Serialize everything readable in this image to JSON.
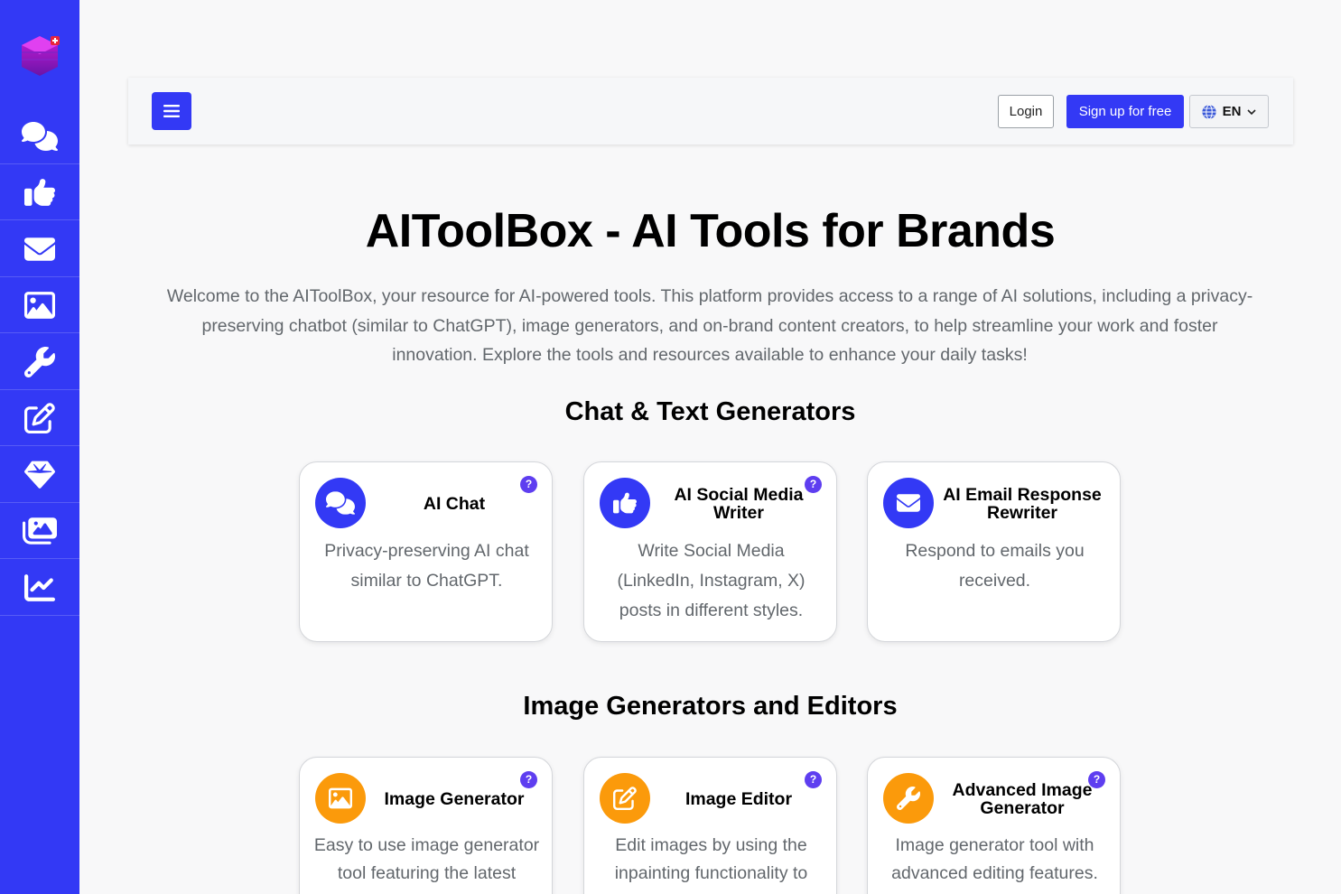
{
  "header": {
    "login_label": "Login",
    "signup_label": "Sign up for free",
    "language_code": "EN"
  },
  "hero": {
    "title": "AIToolBox - AI Tools for Brands",
    "description": "Welcome to the AIToolBox, your resource for AI-powered tools. This platform provides access to a range of AI solutions, including a privacy-preserving chatbot (similar to ChatGPT), image generators, and on-brand content creators, to help streamline your work and foster innovation. Explore the tools and resources available to enhance your daily tasks!"
  },
  "sidebar": {
    "items": [
      {
        "icon": "comments-icon"
      },
      {
        "icon": "thumbs-up-icon"
      },
      {
        "icon": "envelope-icon"
      },
      {
        "icon": "image-icon"
      },
      {
        "icon": "wrench-icon"
      },
      {
        "icon": "edit-icon"
      },
      {
        "icon": "diamond-icon"
      },
      {
        "icon": "images-icon"
      },
      {
        "icon": "chart-line-icon"
      }
    ]
  },
  "sections": [
    {
      "title": "Chat & Text Generators",
      "cards": [
        {
          "title": "AI Chat",
          "description": "Privacy-preserving AI chat similar to ChatGPT.",
          "icon": "comments-icon",
          "help": "?"
        },
        {
          "title": "AI Social Media Writer",
          "description": "Write Social Media (LinkedIn, Instagram, X) posts in different styles.",
          "icon": "thumbs-up-icon",
          "help": "?"
        },
        {
          "title": "AI Email Response Rewriter",
          "description": "Respond to emails you received.",
          "icon": "envelope-icon",
          "help": "?"
        }
      ]
    },
    {
      "title": "Image Generators and Editors",
      "cards": [
        {
          "title": "Image Generator",
          "description": "Easy to use image generator tool featuring the latest",
          "icon": "image-icon",
          "help": "?"
        },
        {
          "title": "Image Editor",
          "description": "Edit images by using the inpainting functionality to",
          "icon": "edit-icon",
          "help": "?"
        },
        {
          "title": "Advanced Image Generator",
          "description": "Image generator tool with advanced editing features.",
          "icon": "wrench-icon",
          "help": "?"
        }
      ]
    }
  ],
  "colors": {
    "brand": "#3339f5",
    "accent_orange": "#fb9a0b",
    "help_badge": "#5e3ef0"
  }
}
